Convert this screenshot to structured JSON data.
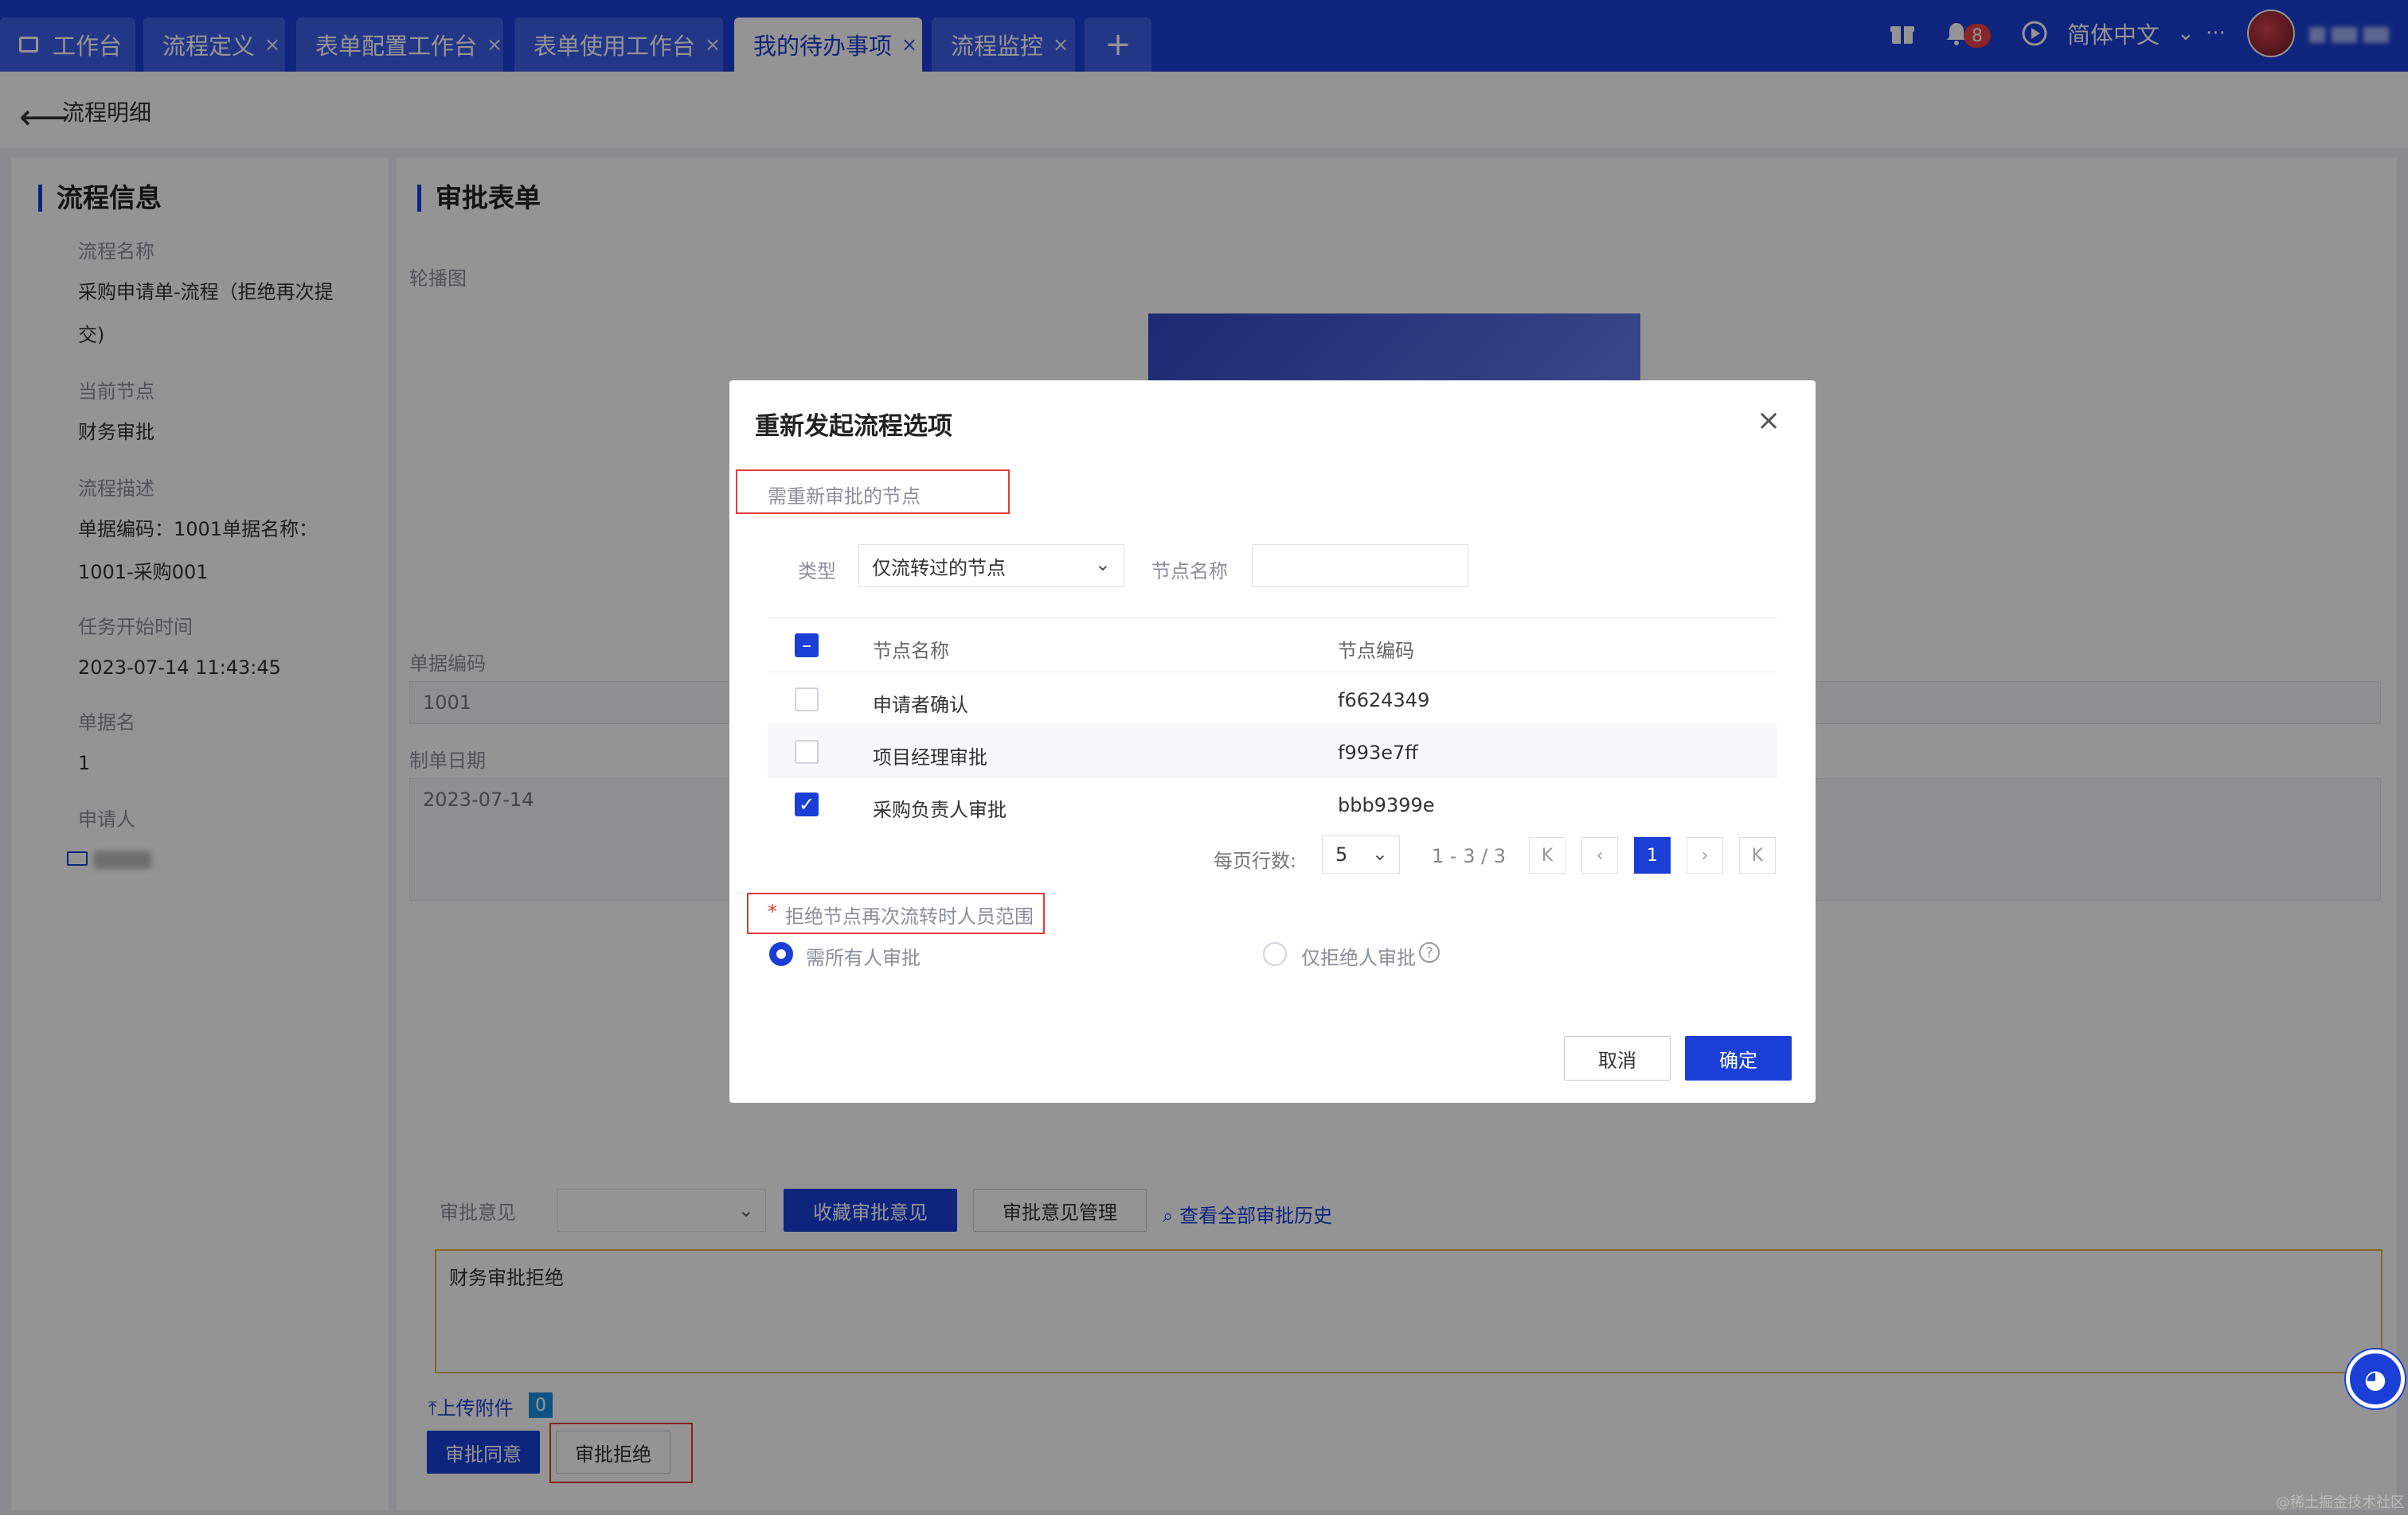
{
  "tabs": [
    {
      "label": "工作台",
      "icon": "monitor-icon",
      "closable": false
    },
    {
      "label": "流程定义",
      "closable": true
    },
    {
      "label": "表单配置工作台",
      "closable": true
    },
    {
      "label": "表单使用工作台",
      "closable": true
    },
    {
      "label": "我的待办事项",
      "closable": true,
      "active": true
    },
    {
      "label": "流程监控",
      "closable": true
    }
  ],
  "tab_close": "×",
  "tab_add": "+",
  "header": {
    "notification_count": "8",
    "language": "简体中文",
    "more": "···",
    "language_chevron": "⌄"
  },
  "page": {
    "title": "流程明细",
    "back": "⟵"
  },
  "process_info": {
    "title": "流程信息",
    "fields": [
      {
        "label": "流程名称",
        "value": "采购申请单-流程（拒绝再次提交)"
      },
      {
        "label": "当前节点",
        "value": "财务审批"
      },
      {
        "label": "流程描述",
        "value": "单据编码：1001单据名称：1001-采购001"
      },
      {
        "label": "任务开始时间",
        "value": "2023-07-14 11:43:45"
      },
      {
        "label": "单据名",
        "value": "1"
      },
      {
        "label": "申请人",
        "value": ""
      }
    ]
  },
  "approval_form": {
    "title": "审批表单",
    "carousel_label": "轮播图",
    "doc_code_label": "单据编码",
    "doc_code_value": "1001",
    "doc_date_label": "制单日期",
    "doc_date_value": "2023-07-14",
    "opinion_label": "审批意见",
    "collect_opinion": "收藏审批意见",
    "manage_opinion": "审批意见管理",
    "view_history": "查看全部审批历史",
    "opinion_text": "财务审批拒绝",
    "upload": "上传附件",
    "upload_count": "0",
    "approve": "审批同意",
    "reject": "审批拒绝"
  },
  "modal": {
    "title": "重新发起流程选项",
    "close": "×",
    "section_nodes": "需重新审批的节点",
    "type_label": "类型",
    "type_value": "仅流转过的节点",
    "node_name_label": "节点名称",
    "node_name_value": "",
    "columns": [
      "节点名称",
      "节点编码"
    ],
    "rows": [
      {
        "name": "申请者确认",
        "code": "f6624349",
        "checked": false
      },
      {
        "name": "项目经理审批",
        "code": "f993e7ff",
        "checked": false
      },
      {
        "name": "采购负责人审批",
        "code": "bbb9399e",
        "checked": true
      }
    ],
    "pager": {
      "per_page_label": "每页行数:",
      "per_page": "5",
      "range": "1 - 3 / 3",
      "current": "1",
      "first": "K",
      "prev": "‹",
      "next": "›",
      "last": "K"
    },
    "scope_label": "拒绝节点再次流转时人员范围",
    "required_mark": "*",
    "option_all": "需所有人审批",
    "option_rejector": "仅拒绝人审批",
    "help": "?",
    "cancel": "取消",
    "confirm": "确定"
  },
  "watermark": "@稀土掘金技术社区",
  "colors": {
    "primary": "#1b3fd6",
    "danger": "#e23a3a",
    "opinion_border": "#e3b347"
  }
}
